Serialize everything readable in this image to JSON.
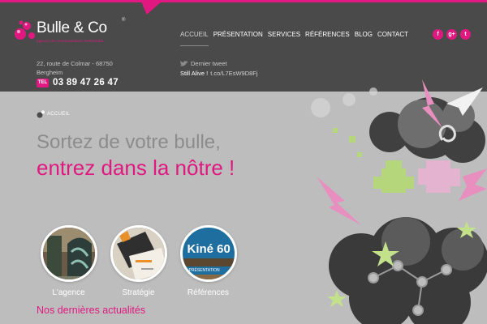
{
  "brand": {
    "name": "Bulle & Co",
    "registered": "®",
    "tagline": "agence de communication multimédia",
    "accent_color": "#e0187f"
  },
  "contact": {
    "address_line1": "22, route de Colmar - 68750",
    "address_line2": "Bergheim",
    "phone_icon_text": "TEL",
    "phone": "03 89 47 26 47"
  },
  "nav": {
    "items": [
      "Accueil",
      "Présentation",
      "Services",
      "Références",
      "Blog",
      "Contact"
    ],
    "active_index": 0
  },
  "tweet": {
    "heading": "Dernier tweet",
    "text": "Still Alive !",
    "link": "t.co/L7EsW9D8Fj"
  },
  "social": {
    "facebook": "f",
    "google": "g+",
    "twitter": "t"
  },
  "breadcrumb": {
    "label": "Accueil"
  },
  "hero": {
    "subtitle": "Sortez de votre bulle,",
    "title": "entrez dans la nôtre !"
  },
  "cards": [
    {
      "label": "L'agence"
    },
    {
      "label": "Stratégie"
    },
    {
      "label": "Références",
      "image_text": "Kiné 60",
      "image_sub": "PRÉSENTATION"
    }
  ],
  "news": {
    "heading": "Nos dernières actualités"
  },
  "icons": {
    "logo": "bubbles-logo-icon",
    "phone": "phone-icon",
    "tweet": "twitter-bird-icon",
    "breadcrumb": "home-bubble-icon"
  }
}
